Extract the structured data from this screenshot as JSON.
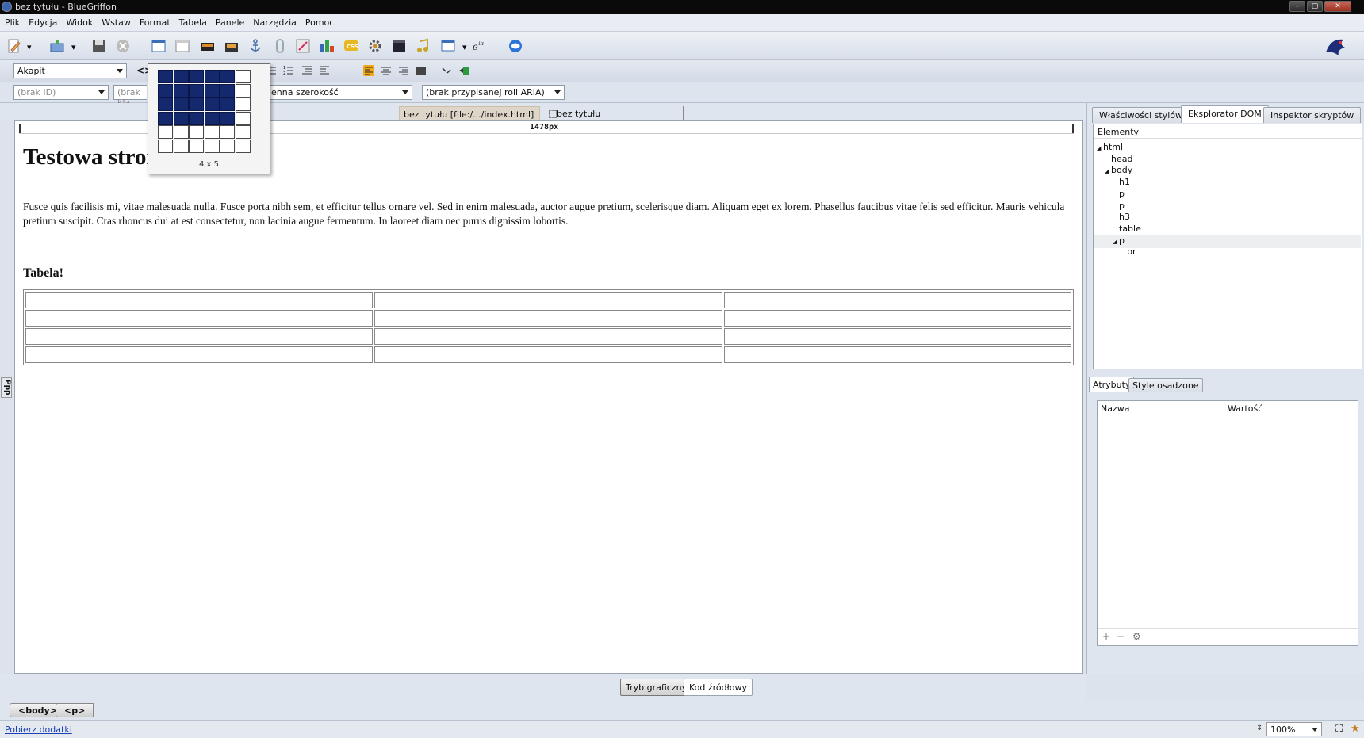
{
  "window": {
    "title": "bez tytułu - BlueGriffon",
    "controls": [
      "–",
      "▢",
      "✕"
    ]
  },
  "menu": [
    "Plik",
    "Edycja",
    "Widok",
    "Wstaw",
    "Format",
    "Tabela",
    "Panele",
    "Narzędzia",
    "Pomoc"
  ],
  "toolbar2": {
    "paragraph_format": "Akapit",
    "code_symbol": "<>"
  },
  "toolbar3": {
    "id_select": "(brak ID)",
    "class_select": "(brak kla",
    "width_select": "enna szerokość",
    "aria_select": "(brak przypisanej roli ARIA)"
  },
  "doc_tabs": {
    "tab_path": "bez tytułu [file:/.../index.html]",
    "tab_title": "bez tytułu"
  },
  "ruler": {
    "label": "1478px"
  },
  "page": {
    "heading": "Testowa strona !!! !!! !!!",
    "paragraph": "Fusce quis facilisis mi, vitae malesuada nulla. Fusce porta nibh sem, et efficitur tellus ornare vel. Sed in enim malesuada, auctor augue pretium, scelerisque diam. Aliquam eget ex lorem. Phasellus faucibus vitae felis sed efficitur. Mauris vehicula pretium suscipit. Cras rhoncus dui at est consectetur, non lacinia augue fermentum. In laoreet diam nec purus dignissim lobortis.",
    "subheading": "Tabela!",
    "table_rows": 4,
    "table_cols": 3
  },
  "table_picker": {
    "label": "4 x 5",
    "rows": 6,
    "cols": 6,
    "selected_rows": 4,
    "selected_cols": 5
  },
  "side_label": "Ppp",
  "mode_buttons": {
    "visual": "Tryb graficzny",
    "source": "Kod źródłowy"
  },
  "breadcrumb": [
    "<body>",
    "<p>"
  ],
  "status": {
    "link": "Pobierz dodatki",
    "zoom": "100%"
  },
  "right_panel": {
    "tabs": [
      "Właściwości stylów",
      "Eksplorator DOM",
      "Inspektor skryptów"
    ],
    "active_tab": "Eksplorator DOM",
    "dom_header": "Elementy",
    "dom_tree": [
      {
        "label": "html",
        "depth": 0,
        "twisty": "◢"
      },
      {
        "label": "head",
        "depth": 1,
        "twisty": ""
      },
      {
        "label": "body",
        "depth": 1,
        "twisty": "◢"
      },
      {
        "label": "h1",
        "depth": 2,
        "twisty": ""
      },
      {
        "label": "p",
        "depth": 2,
        "twisty": ""
      },
      {
        "label": "p",
        "depth": 2,
        "twisty": ""
      },
      {
        "label": "h3",
        "depth": 2,
        "twisty": ""
      },
      {
        "label": "table",
        "depth": 2,
        "twisty": ""
      },
      {
        "label": "p",
        "depth": 2,
        "twisty": "◢",
        "selected": true
      },
      {
        "label": "br",
        "depth": 3,
        "twisty": ""
      }
    ],
    "lower_tabs": [
      "Atrybuty",
      "Style osadzone"
    ],
    "attr_cols": {
      "name": "Nazwa",
      "value": "Wartość"
    },
    "attr_footer": [
      "+",
      "−",
      "⚙"
    ]
  }
}
